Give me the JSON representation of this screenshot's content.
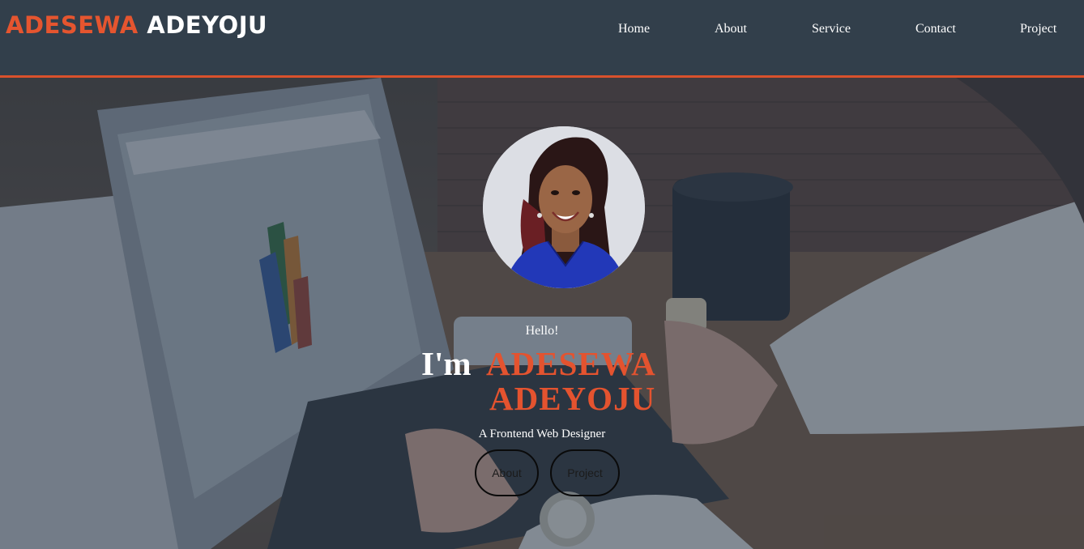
{
  "header": {
    "logo_first": "ADESEWA",
    "logo_last": "ADEYOJU"
  },
  "nav": {
    "items": [
      {
        "label": "Home"
      },
      {
        "label": "About"
      },
      {
        "label": "Service"
      },
      {
        "label": "Contact"
      },
      {
        "label": "Project"
      }
    ]
  },
  "hero": {
    "greeting": "Hello!",
    "intro": "I'm",
    "name_line1": "ADESEWA",
    "name_line2": "ADEYOJU",
    "tagline": "A Frontend Web Designer",
    "buttons": [
      {
        "label": "About"
      },
      {
        "label": "Project"
      }
    ],
    "avatar_icon": "profile-photo",
    "background_icon": "laptop-desk-photo"
  },
  "colors": {
    "accent": "#e4532f",
    "navbar": "#323f4b",
    "text": "#ffffff"
  }
}
